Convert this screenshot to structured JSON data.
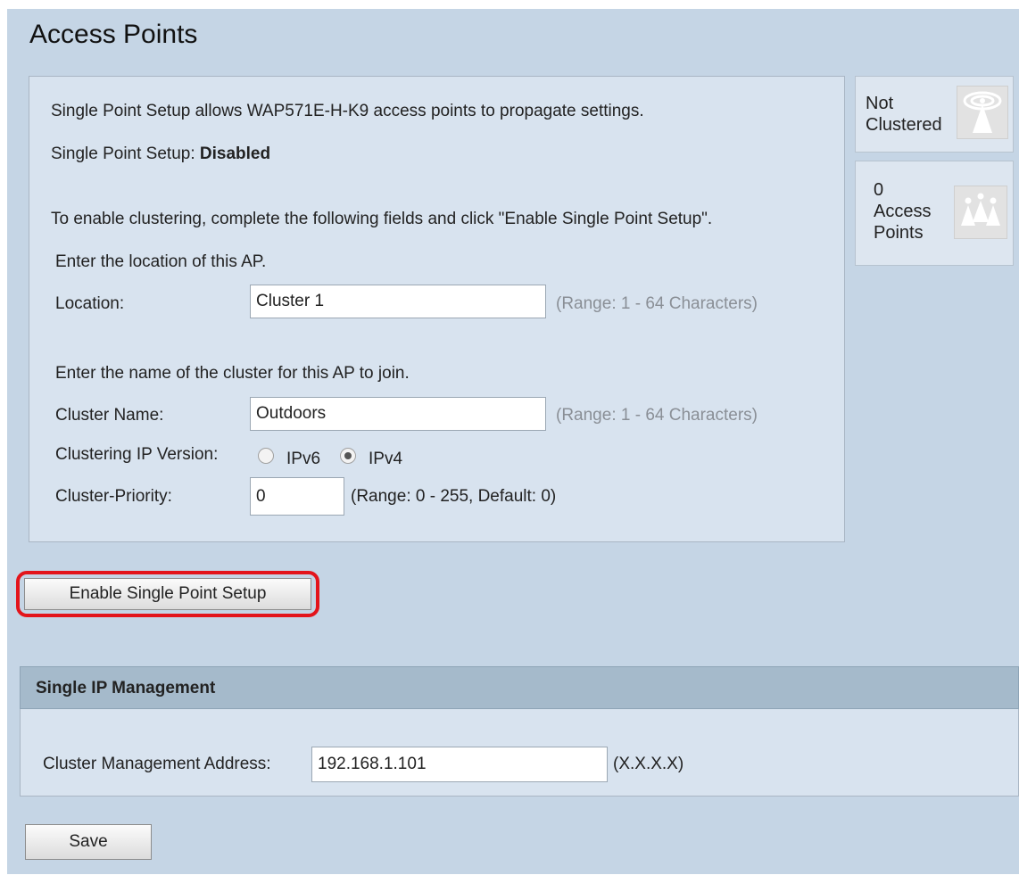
{
  "page": {
    "title": "Access Points"
  },
  "setup": {
    "intro": "Single Point Setup allows WAP571E-H-K9 access points to propagate settings.",
    "status_label": "Single Point Setup: ",
    "status_value": "Disabled",
    "instructions": "To enable clustering, complete the following fields and click \"Enable Single Point Setup\".",
    "location_prompt": "Enter the location of this AP.",
    "location_label": "Location:",
    "location_value": "Cluster 1",
    "location_hint": "(Range: 1 - 64 Characters)",
    "cluster_prompt": "Enter the name of the cluster for this AP to join.",
    "cluster_name_label": "Cluster Name:",
    "cluster_name_value": "Outdoors",
    "cluster_name_hint": "(Range: 1 - 64 Characters)",
    "ip_version_label": "Clustering IP Version:",
    "ip_version_options": [
      "IPv6",
      "IPv4"
    ],
    "ip_version_selected": "IPv4",
    "priority_label": "Cluster-Priority:",
    "priority_value": "0",
    "priority_hint": "(Range: 0 - 255, Default: 0)"
  },
  "side": {
    "cluster_status_line1": "Not",
    "cluster_status_line2": "Clustered",
    "cluster_icon": "antenna-broadcast-icon",
    "ap_count": "0",
    "ap_label_line1": "Access",
    "ap_label_line2": "Points",
    "ap_icon": "access-points-group-icon"
  },
  "actions": {
    "enable_label": "Enable Single Point Setup",
    "save_label": "Save"
  },
  "single_ip": {
    "header": "Single IP Management",
    "address_label": "Cluster Management Address:",
    "address_value": "192.168.1.101",
    "address_hint": "(X.X.X.X)"
  },
  "colors": {
    "page_bg": "#c5d5e5",
    "panel_bg": "#d8e3ef",
    "highlight": "#e3141b",
    "section_header": "#a5bacb"
  }
}
